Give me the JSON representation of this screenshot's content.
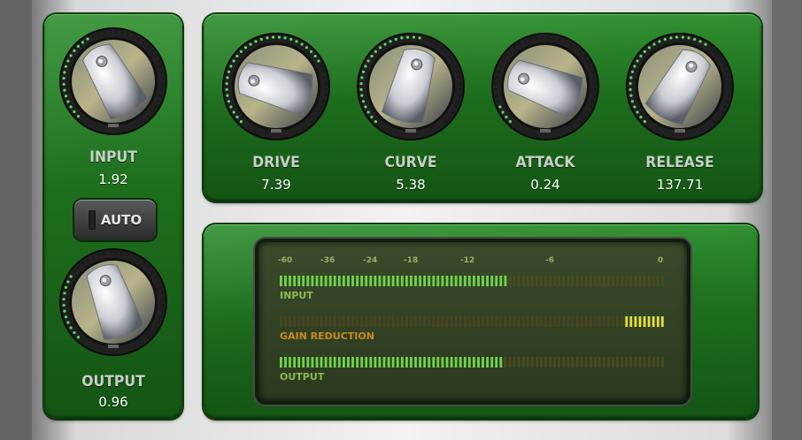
{
  "left": {
    "input": {
      "label": "INPUT",
      "value": "1.92"
    },
    "auto_label": "AUTO",
    "output": {
      "label": "OUTPUT",
      "value": "0.96"
    }
  },
  "top": {
    "drive": {
      "label": "DRIVE",
      "value": "7.39"
    },
    "curve": {
      "label": "CURVE",
      "value": "5.38"
    },
    "attack": {
      "label": "ATTACK",
      "value": "0.24"
    },
    "release": {
      "label": "RELEASE",
      "value": "137.71"
    }
  },
  "meter": {
    "scale": [
      "-60",
      "-36",
      "-24",
      "-18",
      "-12",
      "-6",
      "0"
    ],
    "input": {
      "label": "INPUT",
      "level": 0.59
    },
    "gain_reduction": {
      "label": "GAIN REDUCTION",
      "level": 0.11
    },
    "output": {
      "label": "OUTPUT",
      "level": 0.57
    }
  },
  "colors": {
    "panel": "#1f6f1f",
    "meter_green": "#6fd54a",
    "meter_yellow": "#e6df3a",
    "label_text": "#c7d1c7"
  }
}
